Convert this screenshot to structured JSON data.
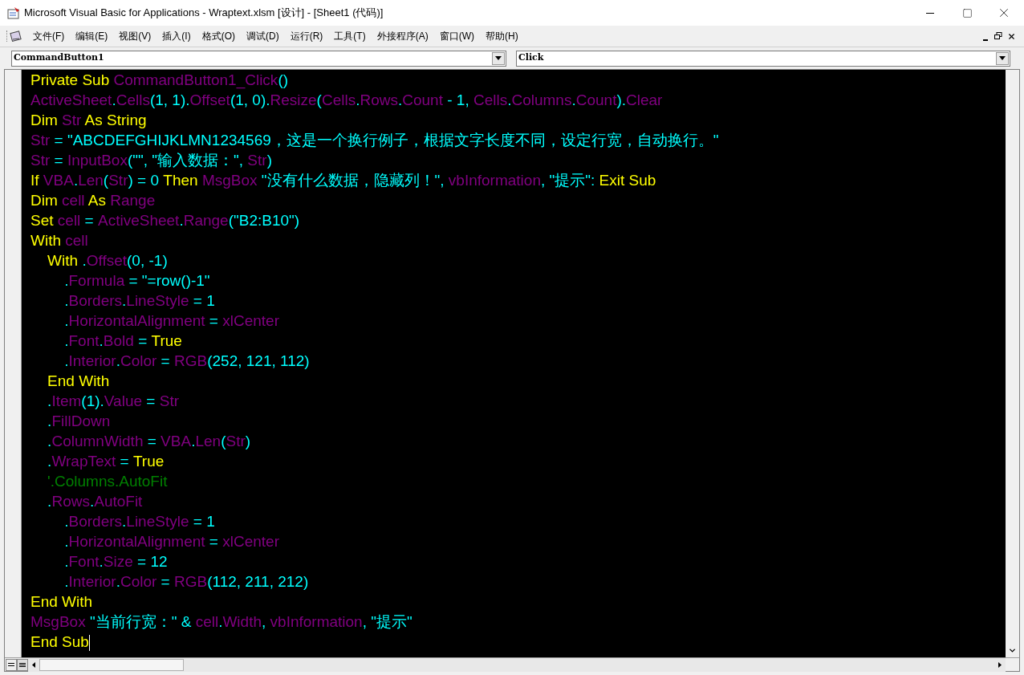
{
  "window": {
    "title": "Microsoft Visual Basic for Applications - Wraptext.xlsm [设计] - [Sheet1 (代码)]"
  },
  "menu": [
    "文件(F)",
    "编辑(E)",
    "视图(V)",
    "插入(I)",
    "格式(O)",
    "调试(D)",
    "运行(R)",
    "工具(T)",
    "外接程序(A)",
    "窗口(W)",
    "帮助(H)"
  ],
  "object_box": {
    "value": "CommandButton1"
  },
  "procedure_box": {
    "value": "Click"
  },
  "code": [
    [
      {
        "text": "Private Sub ",
        "kind": "keyword"
      },
      {
        "text": "CommandButton1_Click",
        "kind": "member"
      },
      {
        "text": "()",
        "kind": "plain"
      }
    ],
    [
      {
        "text": "ActiveSheet",
        "kind": "member"
      },
      {
        "text": ".",
        "kind": "plain"
      },
      {
        "text": "Cells",
        "kind": "member"
      },
      {
        "text": "(1, 1).",
        "kind": "plain"
      },
      {
        "text": "Offset",
        "kind": "member"
      },
      {
        "text": "(1, 0).",
        "kind": "plain"
      },
      {
        "text": "Resize",
        "kind": "member"
      },
      {
        "text": "(",
        "kind": "plain"
      },
      {
        "text": "Cells",
        "kind": "member"
      },
      {
        "text": ".",
        "kind": "plain"
      },
      {
        "text": "Rows",
        "kind": "member"
      },
      {
        "text": ".",
        "kind": "plain"
      },
      {
        "text": "Count",
        "kind": "member"
      },
      {
        "text": " - 1, ",
        "kind": "plain"
      },
      {
        "text": "Cells",
        "kind": "member"
      },
      {
        "text": ".",
        "kind": "plain"
      },
      {
        "text": "Columns",
        "kind": "member"
      },
      {
        "text": ".",
        "kind": "plain"
      },
      {
        "text": "Count",
        "kind": "member"
      },
      {
        "text": ").",
        "kind": "plain"
      },
      {
        "text": "Clear",
        "kind": "member"
      }
    ],
    [
      {
        "text": "Dim ",
        "kind": "keyword"
      },
      {
        "text": "Str",
        "kind": "member"
      },
      {
        "text": " As String",
        "kind": "keyword"
      }
    ],
    [
      {
        "text": "Str",
        "kind": "member"
      },
      {
        "text": " = \"ABCDEFGHIJKLMN1234569，这是一个换行例子，根据文字长度不同，设定行宽，自动换行。\"",
        "kind": "plain"
      }
    ],
    [
      {
        "text": "Str",
        "kind": "member"
      },
      {
        "text": " = ",
        "kind": "plain"
      },
      {
        "text": "InputBox",
        "kind": "member"
      },
      {
        "text": "(\"\", \"输入数据：\", ",
        "kind": "plain"
      },
      {
        "text": "Str",
        "kind": "member"
      },
      {
        "text": ")",
        "kind": "plain"
      }
    ],
    [
      {
        "text": "If ",
        "kind": "keyword"
      },
      {
        "text": "VBA",
        "kind": "member"
      },
      {
        "text": ".",
        "kind": "plain"
      },
      {
        "text": "Len",
        "kind": "member"
      },
      {
        "text": "(",
        "kind": "plain"
      },
      {
        "text": "Str",
        "kind": "member"
      },
      {
        "text": ") = 0 ",
        "kind": "plain"
      },
      {
        "text": "Then ",
        "kind": "keyword"
      },
      {
        "text": "MsgBox",
        "kind": "member"
      },
      {
        "text": " \"没有什么数据，隐藏列！\", ",
        "kind": "plain"
      },
      {
        "text": "vbInformation",
        "kind": "member"
      },
      {
        "text": ", \"提示\": ",
        "kind": "plain"
      },
      {
        "text": "Exit Sub",
        "kind": "keyword"
      }
    ],
    [
      {
        "text": "Dim ",
        "kind": "keyword"
      },
      {
        "text": "cell",
        "kind": "member"
      },
      {
        "text": " As ",
        "kind": "keyword"
      },
      {
        "text": "Range",
        "kind": "member"
      }
    ],
    [
      {
        "text": "Set ",
        "kind": "keyword"
      },
      {
        "text": "cell",
        "kind": "member"
      },
      {
        "text": " = ",
        "kind": "plain"
      },
      {
        "text": "ActiveSheet",
        "kind": "member"
      },
      {
        "text": ".",
        "kind": "plain"
      },
      {
        "text": "Range",
        "kind": "member"
      },
      {
        "text": "(\"B2:B10\")",
        "kind": "plain"
      }
    ],
    [
      {
        "text": "With ",
        "kind": "keyword"
      },
      {
        "text": "cell",
        "kind": "member"
      }
    ],
    [
      {
        "text": "    With ",
        "kind": "keyword"
      },
      {
        "text": ".",
        "kind": "plain"
      },
      {
        "text": "Offset",
        "kind": "member"
      },
      {
        "text": "(0, -1)",
        "kind": "plain"
      }
    ],
    [
      {
        "text": "        .",
        "kind": "plain"
      },
      {
        "text": "Formula",
        "kind": "member"
      },
      {
        "text": " = \"=row()-1\"",
        "kind": "plain"
      }
    ],
    [
      {
        "text": "        .",
        "kind": "plain"
      },
      {
        "text": "Borders",
        "kind": "member"
      },
      {
        "text": ".",
        "kind": "plain"
      },
      {
        "text": "LineStyle",
        "kind": "member"
      },
      {
        "text": " = 1",
        "kind": "plain"
      }
    ],
    [
      {
        "text": "        .",
        "kind": "plain"
      },
      {
        "text": "HorizontalAlignment",
        "kind": "member"
      },
      {
        "text": " = ",
        "kind": "plain"
      },
      {
        "text": "xlCenter",
        "kind": "member"
      }
    ],
    [
      {
        "text": "        .",
        "kind": "plain"
      },
      {
        "text": "Font",
        "kind": "member"
      },
      {
        "text": ".",
        "kind": "plain"
      },
      {
        "text": "Bold",
        "kind": "member"
      },
      {
        "text": " = ",
        "kind": "plain"
      },
      {
        "text": "True",
        "kind": "keyword"
      }
    ],
    [
      {
        "text": "        .",
        "kind": "plain"
      },
      {
        "text": "Interior",
        "kind": "member"
      },
      {
        "text": ".",
        "kind": "plain"
      },
      {
        "text": "Color",
        "kind": "member"
      },
      {
        "text": " = ",
        "kind": "plain"
      },
      {
        "text": "RGB",
        "kind": "member"
      },
      {
        "text": "(252, 121, 112)",
        "kind": "plain"
      }
    ],
    [
      {
        "text": "    End With",
        "kind": "keyword"
      }
    ],
    [
      {
        "text": "    .",
        "kind": "plain"
      },
      {
        "text": "Item",
        "kind": "member"
      },
      {
        "text": "(1).",
        "kind": "plain"
      },
      {
        "text": "Value",
        "kind": "member"
      },
      {
        "text": " = ",
        "kind": "plain"
      },
      {
        "text": "Str",
        "kind": "member"
      }
    ],
    [
      {
        "text": "    .",
        "kind": "plain"
      },
      {
        "text": "FillDown",
        "kind": "member"
      }
    ],
    [
      {
        "text": "    .",
        "kind": "plain"
      },
      {
        "text": "ColumnWidth",
        "kind": "member"
      },
      {
        "text": " = ",
        "kind": "plain"
      },
      {
        "text": "VBA",
        "kind": "member"
      },
      {
        "text": ".",
        "kind": "plain"
      },
      {
        "text": "Len",
        "kind": "member"
      },
      {
        "text": "(",
        "kind": "plain"
      },
      {
        "text": "Str",
        "kind": "member"
      },
      {
        "text": ")",
        "kind": "plain"
      }
    ],
    [
      {
        "text": "    .",
        "kind": "plain"
      },
      {
        "text": "WrapText",
        "kind": "member"
      },
      {
        "text": " = ",
        "kind": "plain"
      },
      {
        "text": "True",
        "kind": "keyword"
      }
    ],
    [
      {
        "text": "    '.Columns.AutoFit",
        "kind": "comment"
      }
    ],
    [
      {
        "text": "    .",
        "kind": "plain"
      },
      {
        "text": "Rows",
        "kind": "member"
      },
      {
        "text": ".",
        "kind": "plain"
      },
      {
        "text": "AutoFit",
        "kind": "member"
      }
    ],
    [
      {
        "text": "        .",
        "kind": "plain"
      },
      {
        "text": "Borders",
        "kind": "member"
      },
      {
        "text": ".",
        "kind": "plain"
      },
      {
        "text": "LineStyle",
        "kind": "member"
      },
      {
        "text": " = 1",
        "kind": "plain"
      }
    ],
    [
      {
        "text": "        .",
        "kind": "plain"
      },
      {
        "text": "HorizontalAlignment",
        "kind": "member"
      },
      {
        "text": " = ",
        "kind": "plain"
      },
      {
        "text": "xlCenter",
        "kind": "member"
      }
    ],
    [
      {
        "text": "        .",
        "kind": "plain"
      },
      {
        "text": "Font",
        "kind": "member"
      },
      {
        "text": ".",
        "kind": "plain"
      },
      {
        "text": "Size",
        "kind": "member"
      },
      {
        "text": " = 12",
        "kind": "plain"
      }
    ],
    [
      {
        "text": "        .",
        "kind": "plain"
      },
      {
        "text": "Interior",
        "kind": "member"
      },
      {
        "text": ".",
        "kind": "plain"
      },
      {
        "text": "Color",
        "kind": "member"
      },
      {
        "text": " = ",
        "kind": "plain"
      },
      {
        "text": "RGB",
        "kind": "member"
      },
      {
        "text": "(112, 211, 212)",
        "kind": "plain"
      }
    ],
    [
      {
        "text": "End With",
        "kind": "keyword"
      }
    ],
    [
      {
        "text": "MsgBox",
        "kind": "member"
      },
      {
        "text": " \"当前行宽：\" & ",
        "kind": "plain"
      },
      {
        "text": "cell",
        "kind": "member"
      },
      {
        "text": ".",
        "kind": "plain"
      },
      {
        "text": "Width",
        "kind": "member"
      },
      {
        "text": ", ",
        "kind": "plain"
      },
      {
        "text": "vbInformation",
        "kind": "member"
      },
      {
        "text": ", \"提示\"",
        "kind": "plain"
      }
    ],
    [
      {
        "text": "End Sub",
        "kind": "keyword"
      }
    ]
  ]
}
